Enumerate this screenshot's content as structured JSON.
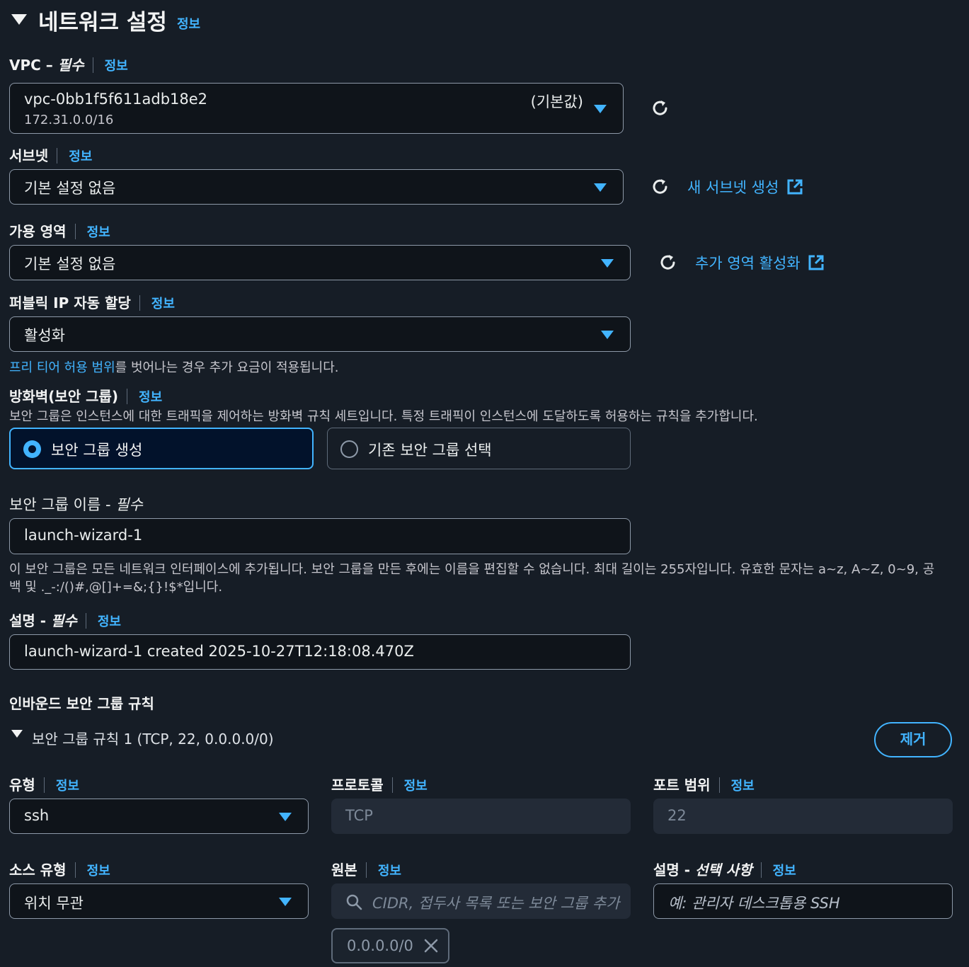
{
  "section": {
    "title": "네트워크 설정",
    "info": "정보"
  },
  "vpc": {
    "label": "VPC – ",
    "label_required": "필수",
    "info": "정보",
    "value": "vpc-0bb1f5f611adb18e2",
    "sub": "172.31.0.0/16",
    "tag": "(기본값)"
  },
  "subnet": {
    "label": "서브넷",
    "info": "정보",
    "value": "기본 설정 없음",
    "link": "새 서브넷 생성"
  },
  "az": {
    "label": "가용 영역",
    "info": "정보",
    "value": "기본 설정 없음",
    "link": "추가 영역 활성화"
  },
  "public_ip": {
    "label": "퍼블릭 IP 자동 할당",
    "info": "정보",
    "value": "활성화",
    "help_link": "프리 티어 허용 범위",
    "help_rest": "를 벗어나는 경우 추가 요금이 적용됩니다."
  },
  "firewall": {
    "label": "방화벽(보안 그룹)",
    "info": "정보",
    "desc": "보안 그룹은 인스턴스에 대한 트래픽을 제어하는 방화벽 규칙 세트입니다. 특정 트래픽이 인스턴스에 도달하도록 허용하는 규칙을 추가합니다.",
    "option_create": "보안 그룹 생성",
    "option_existing": "기존 보안 그룹 선택",
    "selected": "create"
  },
  "sg_name": {
    "label": "보안 그룹 이름 - ",
    "label_required": "필수",
    "value": "launch-wizard-1",
    "help_line1": "이 보안 그룹은 모든 네트워크 인터페이스에 추가됩니다. 보안 그룹을 만든 후에는 이름을 편집할 수 없습니다. 최대 길이는 255자입니다. 유효한 문자는 a~z, A~Z, 0~9, 공",
    "help_line2": "백 및 ._-:/()#,@[]+=&;{}!$*입니다."
  },
  "sg_desc": {
    "label": "설명 - ",
    "label_required": "필수",
    "info": "정보",
    "value": "launch-wizard-1 created 2025-10-27T12:18:08.470Z"
  },
  "inbound": {
    "title": "인바운드 보안 그룹 규칙",
    "rule_title": "보안 그룹 규칙 1 (TCP, 22, 0.0.0.0/0)",
    "remove": "제거",
    "type_label": "유형",
    "type_value": "ssh",
    "protocol_label": "프로토콜",
    "protocol_value": "TCP",
    "port_label": "포트 범위",
    "port_value": "22",
    "source_type_label": "소스 유형",
    "source_type_value": "위치 무관",
    "source_label": "원본",
    "source_placeholder": "CIDR, 접두사 목록 또는 보안 그룹 추가",
    "source_token": "0.0.0.0/0",
    "desc_label": "설명 - ",
    "desc_label_opt": "선택 사항",
    "desc_placeholder": "예: 관리자 데스크톱용 SSH",
    "info": "정보"
  },
  "colors": {
    "accent": "#42b4ff",
    "background": "#161d26",
    "input_bg": "#0f141a",
    "border": "#8d99a8"
  }
}
